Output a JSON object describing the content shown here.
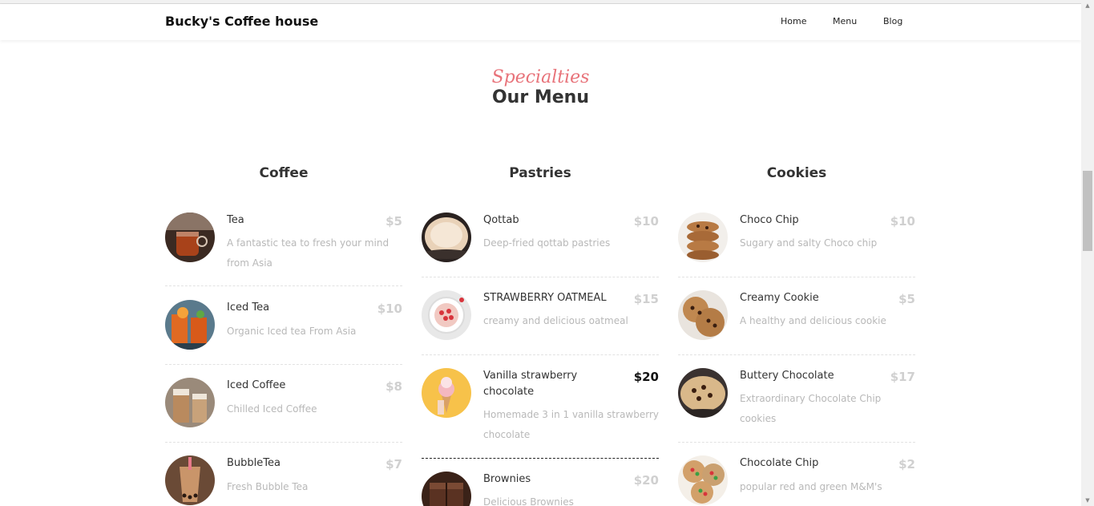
{
  "nav": {
    "brand": "Bucky's Coffee house",
    "links": [
      "Home",
      "Menu",
      "Blog"
    ]
  },
  "heading": {
    "script": "Specialties",
    "title": "Our Menu"
  },
  "columns": [
    {
      "title": "Coffee",
      "items": [
        {
          "name": "Tea",
          "price": "$5",
          "desc": "A fantastic tea to fresh your mind from Asia",
          "thumb": "tea-image"
        },
        {
          "name": "Iced Tea",
          "price": "$10",
          "desc": "Organic Iced tea From Asia",
          "thumb": "iced-tea-image"
        },
        {
          "name": "Iced Coffee",
          "price": "$8",
          "desc": "Chilled Iced Coffee",
          "thumb": "iced-coffee-image"
        },
        {
          "name": "BubbleTea",
          "price": "$7",
          "desc": "Fresh Bubble Tea",
          "thumb": "bubble-tea-image"
        }
      ]
    },
    {
      "title": "Pastries",
      "items": [
        {
          "name": "Qottab",
          "price": "$10",
          "desc": "Deep-fried qottab pastries",
          "thumb": "qottab-image"
        },
        {
          "name": "STRAWBERRY OATMEAL",
          "price": "$15",
          "desc": "creamy and delicious oatmeal",
          "thumb": "oatmeal-image"
        },
        {
          "name": "Vanilla strawberry chocolate",
          "price": "$20",
          "desc": "Homemade 3 in 1 vanilla strawberry chocolate",
          "thumb": "ice-cream-image"
        },
        {
          "name": "Brownies",
          "price": "$20",
          "desc": "Delicious Brownies",
          "thumb": "brownies-image"
        }
      ]
    },
    {
      "title": "Cookies",
      "items": [
        {
          "name": "Choco Chip",
          "price": "$10",
          "desc": "Sugary and salty Choco chip",
          "thumb": "choco-chip-image"
        },
        {
          "name": "Creamy Cookie",
          "price": "$5",
          "desc": "A healthy and delicious cookie",
          "thumb": "creamy-cookie-image"
        },
        {
          "name": "Buttery Chocolate",
          "price": "$17",
          "desc": "Extraordinary Chocolate Chip cookies",
          "thumb": "buttery-chocolate-image"
        },
        {
          "name": "Chocolate Chip",
          "price": "$2",
          "desc": "popular red and green M&M's",
          "thumb": "chocolate-chip-image"
        }
      ]
    }
  ],
  "colors": {
    "script_accent": "#e8737a",
    "muted_price": "#d0d0d0",
    "active_price": "#111111"
  }
}
